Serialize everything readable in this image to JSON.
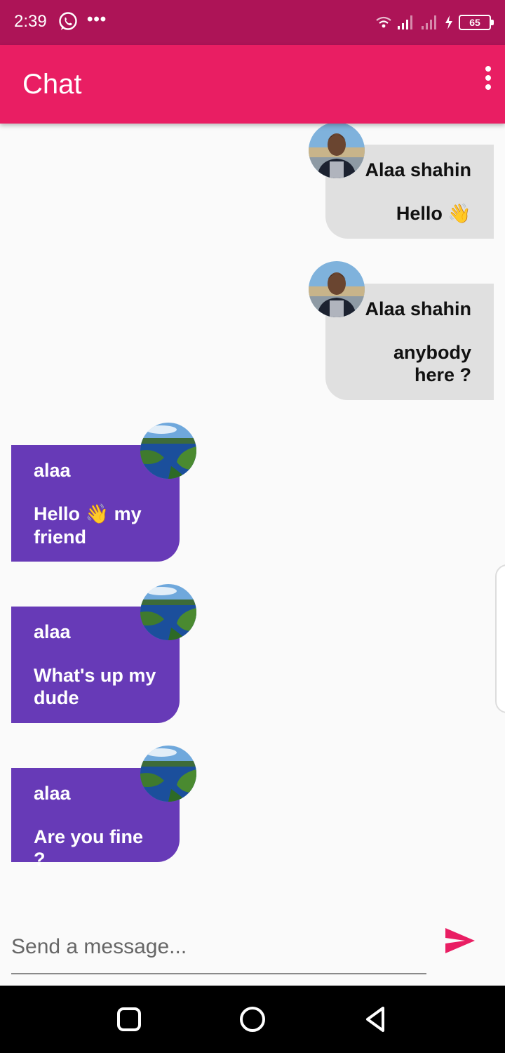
{
  "status_bar": {
    "time": "2:39",
    "battery": "65",
    "icons": [
      "whatsapp-icon",
      "more-notifications-icon",
      "wifi-icon",
      "signal-icon",
      "signal-icon",
      "charging-icon",
      "battery-icon"
    ]
  },
  "app_bar": {
    "title": "Chat",
    "menu_icon": "more-vert-icon"
  },
  "messages": [
    {
      "sender": "Alaa shahin",
      "text": "Hello",
      "emoji": "👋",
      "side": "right",
      "avatar": "profile-photo"
    },
    {
      "sender": "Alaa shahin",
      "text": "anybody here ?",
      "side": "right",
      "avatar": "profile-photo"
    },
    {
      "sender": "alaa",
      "text_before": "Hello",
      "emoji": "👋",
      "text_after": "my friend",
      "side": "left",
      "avatar": "lake-landscape"
    },
    {
      "sender": "alaa",
      "text": "What's up my dude",
      "side": "left",
      "avatar": "lake-landscape"
    },
    {
      "sender": "alaa",
      "text": "Are you fine ?",
      "side": "left",
      "avatar": "lake-landscape"
    }
  ],
  "composer": {
    "placeholder": "Send a message...",
    "send_icon": "send-icon"
  },
  "nav_bar": {
    "icons": [
      "recents-icon",
      "home-icon",
      "back-icon"
    ]
  },
  "colors": {
    "status_bar": "#ad1457",
    "app_bar": "#e91e63",
    "my_bubble": "#e0e0e0",
    "other_bubble": "#673ab7",
    "send_icon": "#e91e63"
  }
}
